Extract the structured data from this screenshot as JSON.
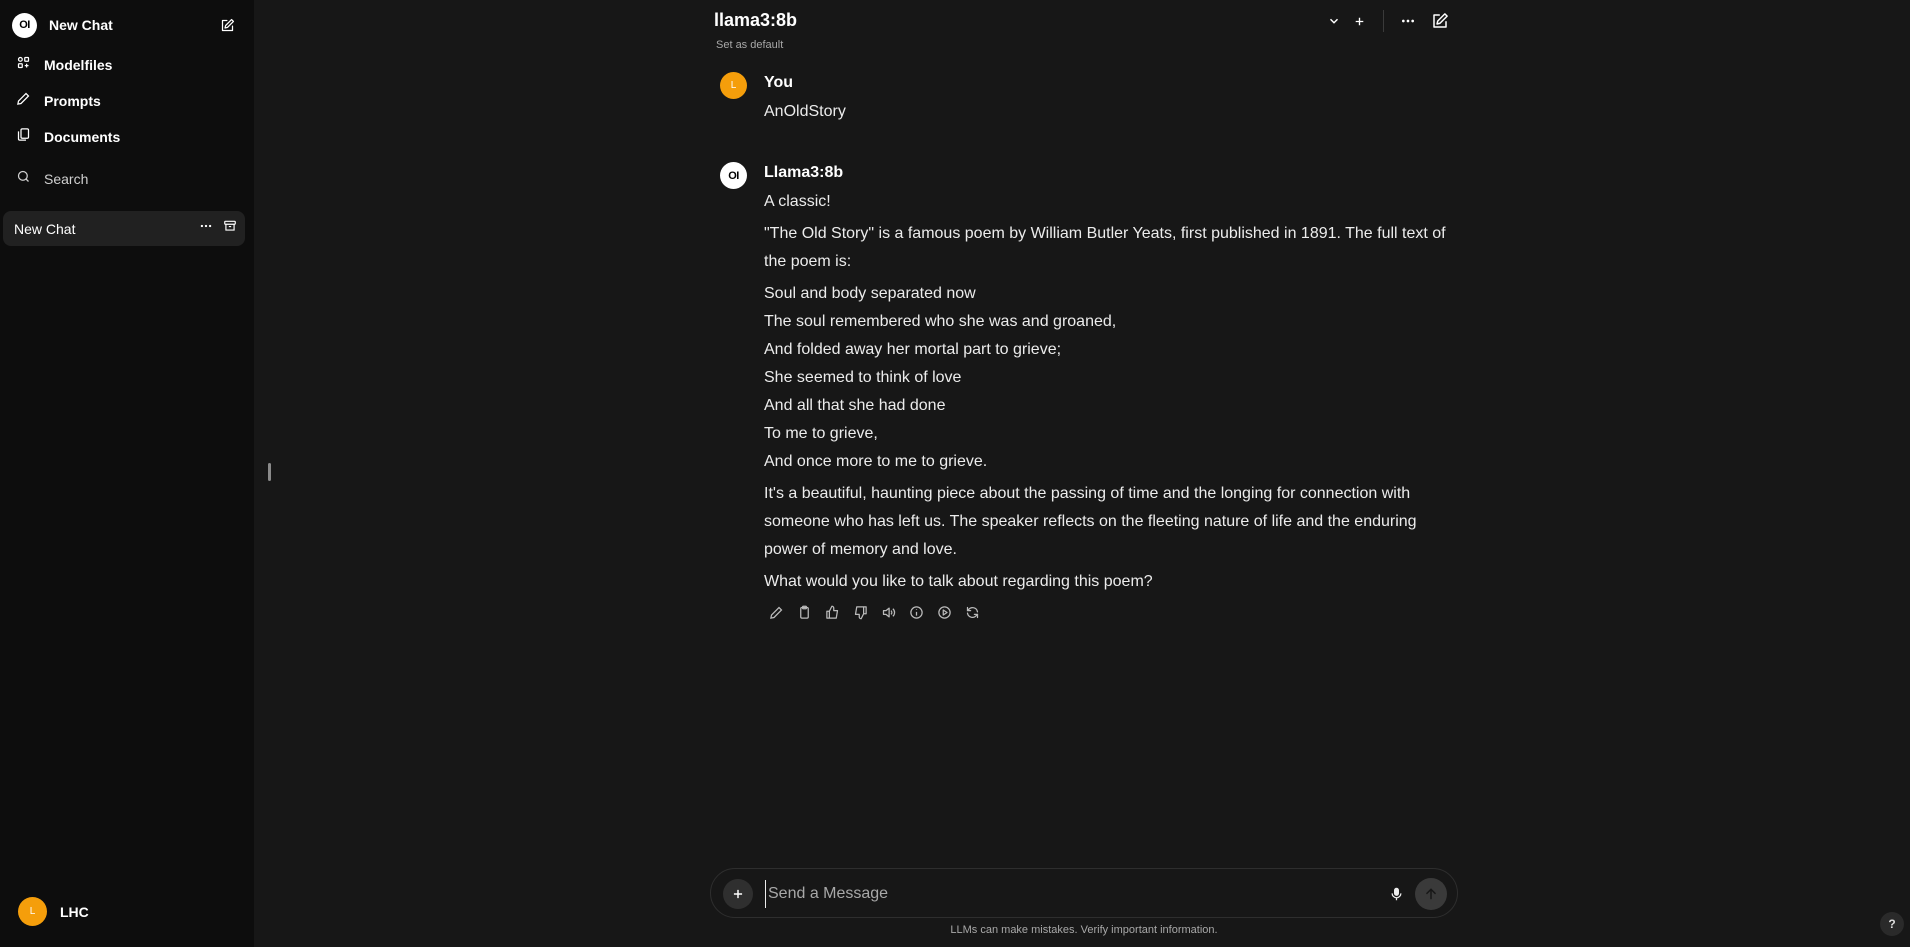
{
  "sidebar": {
    "brand_logo": "OI",
    "new_chat_label": "New Chat",
    "nav": [
      {
        "label": "Modelfiles",
        "icon": "modelfiles-icon"
      },
      {
        "label": "Prompts",
        "icon": "pencil-icon"
      },
      {
        "label": "Documents",
        "icon": "documents-icon"
      }
    ],
    "search_label": "Search",
    "chats": [
      {
        "title": "New Chat"
      }
    ],
    "user": {
      "initial": "L",
      "name": "LHC"
    }
  },
  "header": {
    "model_name": "llama3:8b",
    "set_default_label": "Set as default"
  },
  "messages": [
    {
      "author": "You",
      "avatar_initial": "L",
      "text": "AnOldStory"
    },
    {
      "author": "Llama3:8b",
      "avatar": "OI",
      "intro": "A classic!",
      "para1": "\"The Old Story\" is a famous poem by William Butler Yeats, first published in 1891. The full text of the poem is:",
      "poem": [
        "Soul and body separated now",
        "The soul remembered who she was and groaned,",
        "And folded away her mortal part to grieve;",
        "She seemed to think of love",
        "And all that she had done",
        "To me to grieve,",
        "And once more to me to grieve."
      ],
      "para2": "It's a beautiful, haunting piece about the passing of time and the longing for connection with someone who has left us. The speaker reflects on the fleeting nature of life and the enduring power of memory and love.",
      "para3": "What would you like to talk about regarding this poem?"
    }
  ],
  "composer": {
    "placeholder": "Send a Message",
    "disclaimer": "LLMs can make mistakes. Verify important information."
  },
  "help_label": "?",
  "colors": {
    "accent_avatar": "#f59e0b",
    "background": "#171717",
    "sidebar": "#0d0d0d"
  }
}
